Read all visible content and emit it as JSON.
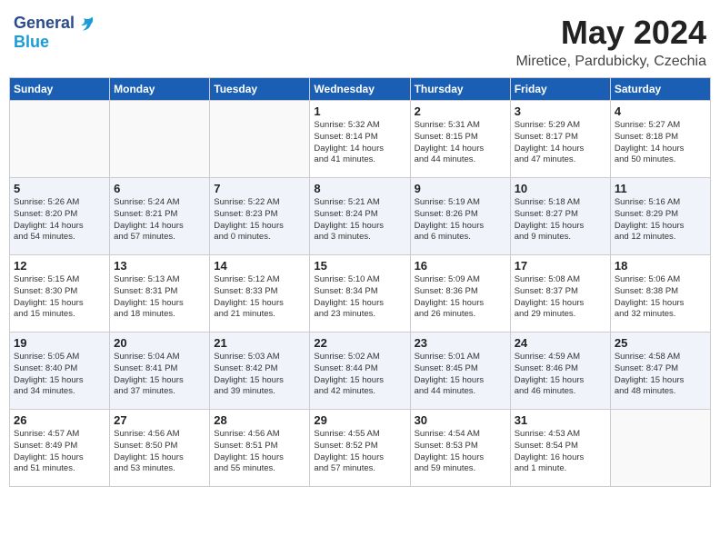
{
  "logo": {
    "general": "General",
    "blue": "Blue"
  },
  "title": "May 2024",
  "location": "Miretice, Pardubicky, Czechia",
  "days_of_week": [
    "Sunday",
    "Monday",
    "Tuesday",
    "Wednesday",
    "Thursday",
    "Friday",
    "Saturday"
  ],
  "weeks": [
    [
      {
        "day": "",
        "info": ""
      },
      {
        "day": "",
        "info": ""
      },
      {
        "day": "",
        "info": ""
      },
      {
        "day": "1",
        "info": "Sunrise: 5:32 AM\nSunset: 8:14 PM\nDaylight: 14 hours\nand 41 minutes."
      },
      {
        "day": "2",
        "info": "Sunrise: 5:31 AM\nSunset: 8:15 PM\nDaylight: 14 hours\nand 44 minutes."
      },
      {
        "day": "3",
        "info": "Sunrise: 5:29 AM\nSunset: 8:17 PM\nDaylight: 14 hours\nand 47 minutes."
      },
      {
        "day": "4",
        "info": "Sunrise: 5:27 AM\nSunset: 8:18 PM\nDaylight: 14 hours\nand 50 minutes."
      }
    ],
    [
      {
        "day": "5",
        "info": "Sunrise: 5:26 AM\nSunset: 8:20 PM\nDaylight: 14 hours\nand 54 minutes."
      },
      {
        "day": "6",
        "info": "Sunrise: 5:24 AM\nSunset: 8:21 PM\nDaylight: 14 hours\nand 57 minutes."
      },
      {
        "day": "7",
        "info": "Sunrise: 5:22 AM\nSunset: 8:23 PM\nDaylight: 15 hours\nand 0 minutes."
      },
      {
        "day": "8",
        "info": "Sunrise: 5:21 AM\nSunset: 8:24 PM\nDaylight: 15 hours\nand 3 minutes."
      },
      {
        "day": "9",
        "info": "Sunrise: 5:19 AM\nSunset: 8:26 PM\nDaylight: 15 hours\nand 6 minutes."
      },
      {
        "day": "10",
        "info": "Sunrise: 5:18 AM\nSunset: 8:27 PM\nDaylight: 15 hours\nand 9 minutes."
      },
      {
        "day": "11",
        "info": "Sunrise: 5:16 AM\nSunset: 8:29 PM\nDaylight: 15 hours\nand 12 minutes."
      }
    ],
    [
      {
        "day": "12",
        "info": "Sunrise: 5:15 AM\nSunset: 8:30 PM\nDaylight: 15 hours\nand 15 minutes."
      },
      {
        "day": "13",
        "info": "Sunrise: 5:13 AM\nSunset: 8:31 PM\nDaylight: 15 hours\nand 18 minutes."
      },
      {
        "day": "14",
        "info": "Sunrise: 5:12 AM\nSunset: 8:33 PM\nDaylight: 15 hours\nand 21 minutes."
      },
      {
        "day": "15",
        "info": "Sunrise: 5:10 AM\nSunset: 8:34 PM\nDaylight: 15 hours\nand 23 minutes."
      },
      {
        "day": "16",
        "info": "Sunrise: 5:09 AM\nSunset: 8:36 PM\nDaylight: 15 hours\nand 26 minutes."
      },
      {
        "day": "17",
        "info": "Sunrise: 5:08 AM\nSunset: 8:37 PM\nDaylight: 15 hours\nand 29 minutes."
      },
      {
        "day": "18",
        "info": "Sunrise: 5:06 AM\nSunset: 8:38 PM\nDaylight: 15 hours\nand 32 minutes."
      }
    ],
    [
      {
        "day": "19",
        "info": "Sunrise: 5:05 AM\nSunset: 8:40 PM\nDaylight: 15 hours\nand 34 minutes."
      },
      {
        "day": "20",
        "info": "Sunrise: 5:04 AM\nSunset: 8:41 PM\nDaylight: 15 hours\nand 37 minutes."
      },
      {
        "day": "21",
        "info": "Sunrise: 5:03 AM\nSunset: 8:42 PM\nDaylight: 15 hours\nand 39 minutes."
      },
      {
        "day": "22",
        "info": "Sunrise: 5:02 AM\nSunset: 8:44 PM\nDaylight: 15 hours\nand 42 minutes."
      },
      {
        "day": "23",
        "info": "Sunrise: 5:01 AM\nSunset: 8:45 PM\nDaylight: 15 hours\nand 44 minutes."
      },
      {
        "day": "24",
        "info": "Sunrise: 4:59 AM\nSunset: 8:46 PM\nDaylight: 15 hours\nand 46 minutes."
      },
      {
        "day": "25",
        "info": "Sunrise: 4:58 AM\nSunset: 8:47 PM\nDaylight: 15 hours\nand 48 minutes."
      }
    ],
    [
      {
        "day": "26",
        "info": "Sunrise: 4:57 AM\nSunset: 8:49 PM\nDaylight: 15 hours\nand 51 minutes."
      },
      {
        "day": "27",
        "info": "Sunrise: 4:56 AM\nSunset: 8:50 PM\nDaylight: 15 hours\nand 53 minutes."
      },
      {
        "day": "28",
        "info": "Sunrise: 4:56 AM\nSunset: 8:51 PM\nDaylight: 15 hours\nand 55 minutes."
      },
      {
        "day": "29",
        "info": "Sunrise: 4:55 AM\nSunset: 8:52 PM\nDaylight: 15 hours\nand 57 minutes."
      },
      {
        "day": "30",
        "info": "Sunrise: 4:54 AM\nSunset: 8:53 PM\nDaylight: 15 hours\nand 59 minutes."
      },
      {
        "day": "31",
        "info": "Sunrise: 4:53 AM\nSunset: 8:54 PM\nDaylight: 16 hours\nand 1 minute."
      },
      {
        "day": "",
        "info": ""
      }
    ]
  ]
}
